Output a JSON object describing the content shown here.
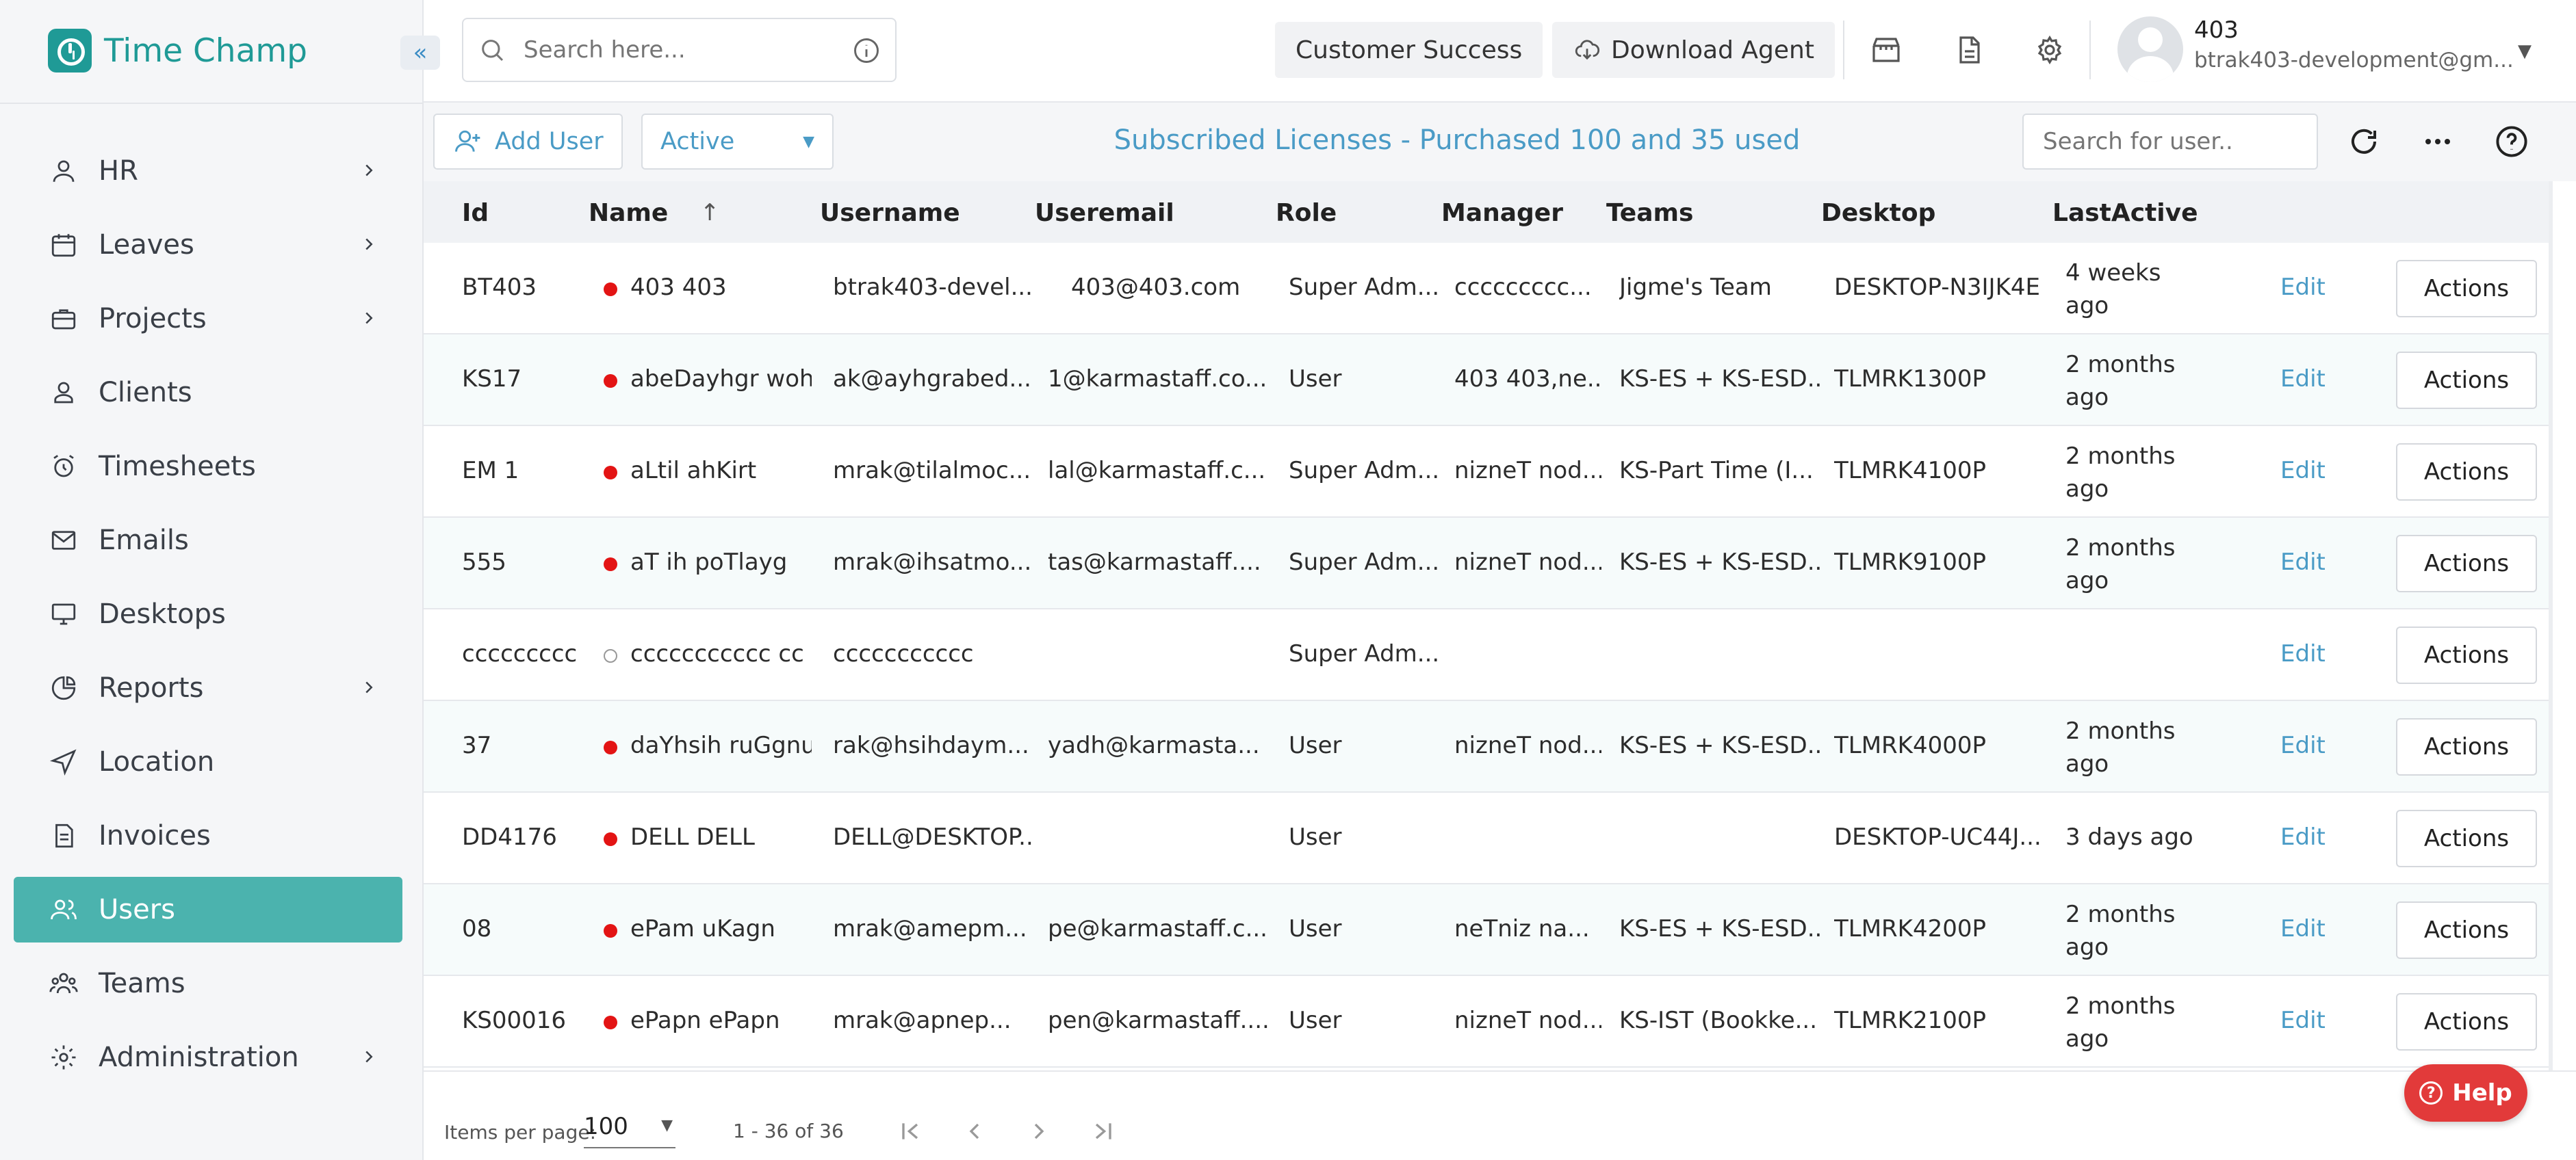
{
  "brand": {
    "name": "Time Champ",
    "collapse_icon": "«"
  },
  "sidebar": {
    "items": [
      {
        "label": "HR",
        "icon": "person-icon",
        "has_children": true
      },
      {
        "label": "Leaves",
        "icon": "calendar-icon",
        "has_children": true
      },
      {
        "label": "Projects",
        "icon": "briefcase-icon",
        "has_children": true
      },
      {
        "label": "Clients",
        "icon": "client-icon",
        "has_children": false
      },
      {
        "label": "Timesheets",
        "icon": "alarm-clock-icon",
        "has_children": false
      },
      {
        "label": "Emails",
        "icon": "mail-icon",
        "has_children": false
      },
      {
        "label": "Desktops",
        "icon": "monitor-icon",
        "has_children": false
      },
      {
        "label": "Reports",
        "icon": "pie-chart-icon",
        "has_children": true
      },
      {
        "label": "Location",
        "icon": "navigation-icon",
        "has_children": false
      },
      {
        "label": "Invoices",
        "icon": "invoice-icon",
        "has_children": false
      },
      {
        "label": "Users",
        "icon": "users-icon",
        "has_children": false,
        "active": true
      },
      {
        "label": "Teams",
        "icon": "team-icon",
        "has_children": false
      },
      {
        "label": "Administration",
        "icon": "gear-icon",
        "has_children": true
      }
    ]
  },
  "header": {
    "search_placeholder": "Search here...",
    "customer_success": "Customer Success",
    "download_agent": "Download Agent",
    "user_name": "403",
    "user_email": "btrak403-development@gm..."
  },
  "toolbar": {
    "add_user": "Add User",
    "status_filter": "Active",
    "licenses_text": "Subscribed Licenses - Purchased 100 and 35 used",
    "user_search_placeholder": "Search for user.."
  },
  "table": {
    "columns": [
      "Id",
      "Name",
      "Username",
      "Useremail",
      "Role",
      "Manager",
      "Teams",
      "Desktop",
      "LastActive"
    ],
    "edit_label": "Edit",
    "actions_label": "Actions",
    "rows": [
      {
        "id": "BT403",
        "name": "403 403",
        "username": "btrak403-devel...",
        "useremail": "403@403.com",
        "role": "Super Adm...",
        "manager": "ccccccccc...",
        "teams": "Jigme's Team",
        "desktop": "DESKTOP-N3IJK4E",
        "last_active": "4 weeks ago",
        "online": true
      },
      {
        "id": "KS17",
        "name": "abeDayhgr woh",
        "username": "ak@ayhgrabed...",
        "useremail": "1@karmastaff.co...",
        "role": "User",
        "manager": "403 403,ne...",
        "teams": "KS-ES + KS-ESD...",
        "desktop": "TLMRK1300P",
        "last_active": "2 months ago",
        "online": true
      },
      {
        "id": "EM 1",
        "name": "aLtil ahKirt",
        "username": "mrak@tilalmoc...",
        "useremail": "lal@karmastaff.c...",
        "role": "Super Adm...",
        "manager": "nizneT nod...",
        "teams": "KS-Part Time (I...",
        "desktop": "TLMRK4100P",
        "last_active": "2 months ago",
        "online": true
      },
      {
        "id": "555",
        "name": "aT ih poTlayg",
        "username": "mrak@ihsatmo...",
        "useremail": "tas@karmastaff....",
        "role": "Super Adm...",
        "manager": "nizneT nod...",
        "teams": "KS-ES + KS-ESD...",
        "desktop": "TLMRK9100P",
        "last_active": "2 months ago",
        "online": true
      },
      {
        "id": "ccccccccc",
        "name": "ccccccccccc cc",
        "username": "ccccccccccc",
        "useremail": "",
        "role": "Super Adm...",
        "manager": "",
        "teams": "",
        "desktop": "",
        "last_active": "",
        "online": false
      },
      {
        "id": "37",
        "name": "daYhsih ruGgnu",
        "username": "rak@hsihdaym...",
        "useremail": "yadh@karmasta...",
        "role": "User",
        "manager": "nizneT nod...",
        "teams": "KS-ES + KS-ESD...",
        "desktop": "TLMRK4000P",
        "last_active": "2 months ago",
        "online": true
      },
      {
        "id": "DD4176",
        "name": "DELL DELL",
        "username": "DELL@DESKTOP...",
        "useremail": "",
        "role": "User",
        "manager": "",
        "teams": "",
        "desktop": "DESKTOP-UC44J...",
        "last_active": "3 days ago",
        "online": true
      },
      {
        "id": "08",
        "name": "ePam uKagn",
        "username": "mrak@amepm...",
        "useremail": "pe@karmastaff.c...",
        "role": "User",
        "manager": "neTniz na...",
        "teams": "KS-ES + KS-ESD...",
        "desktop": "TLMRK4200P",
        "last_active": "2 months ago",
        "online": true
      },
      {
        "id": "KS00016",
        "name": "ePapn ePapn",
        "username": "mrak@apnep...",
        "useremail": "pen@karmastaff....",
        "role": "User",
        "manager": "nizneT nod...",
        "teams": "KS-IST (Bookke...",
        "desktop": "TLMRK2100P",
        "last_active": "2 months ago",
        "online": true
      }
    ]
  },
  "pagination": {
    "items_per_page_label": "Items per page:",
    "items_per_page": "100",
    "range_text": "1 - 36 of 36"
  },
  "help": {
    "label": "Help"
  },
  "colors": {
    "brand": "#1f9a96",
    "accent": "#4a9bc6",
    "active_nav": "#4bb3ae",
    "status_online": "#e31414",
    "help": "#e23a3a"
  }
}
